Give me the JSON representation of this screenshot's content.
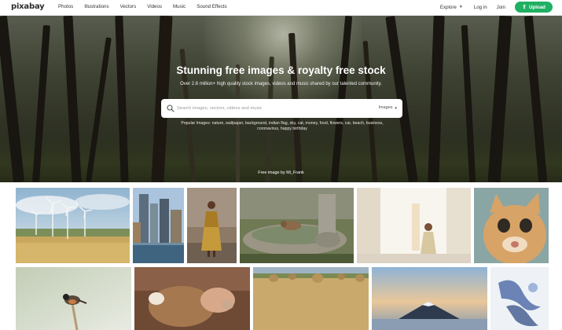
{
  "brand": {
    "logo_text": "pixabay",
    "accent": "#1fb063"
  },
  "nav": {
    "links": [
      "Photos",
      "Illustrations",
      "Vectors",
      "Videos",
      "Music",
      "Sound Effects"
    ],
    "explore": "Explore",
    "login": "Log in",
    "join": "Join",
    "upload": "Upload"
  },
  "hero": {
    "title": "Stunning free images & royalty free stock",
    "subtitle": "Over 2.6 million+ high quality stock images, videos and music shared by our talented community.",
    "search_placeholder": "Search images, vectors, videos and music",
    "search_scope": "Images",
    "popular_label": "Popular Images:",
    "popular_terms": "nature, wallpaper, background, indian flag, sky, cat, money, food, flowers, car, beach, business, coronavirus, happy birthday",
    "credit": "Free image by Mi_Frank"
  },
  "icons": {
    "search": "search-icon",
    "chevron": "chevron-down-icon",
    "upload": "upload-icon"
  },
  "gallery": [
    {
      "name": "wind-turbines-photo",
      "subject": "wind turbines over wheat field"
    },
    {
      "name": "city-skyline-photo",
      "subject": "waterfront skyscrapers"
    },
    {
      "name": "woman-street-photo",
      "subject": "woman in patterned dress"
    },
    {
      "name": "chipmunk-fountain-photo",
      "subject": "chipmunk on stone fountain"
    },
    {
      "name": "girl-hallway-photo",
      "subject": "girl in bright white hallway"
    },
    {
      "name": "surprised-cat-photo",
      "subject": "surprised cat"
    },
    {
      "name": "stonechat-bird-photo",
      "subject": "bird perched on stalk"
    },
    {
      "name": "calf-cow-photo",
      "subject": "calf nursing from cow"
    },
    {
      "name": "hay-bales-photo",
      "subject": "hay bales in field"
    },
    {
      "name": "mount-fuji-photo",
      "subject": "mountain at sunset"
    },
    {
      "name": "blue-ink-photo",
      "subject": "blue ink in water"
    }
  ]
}
